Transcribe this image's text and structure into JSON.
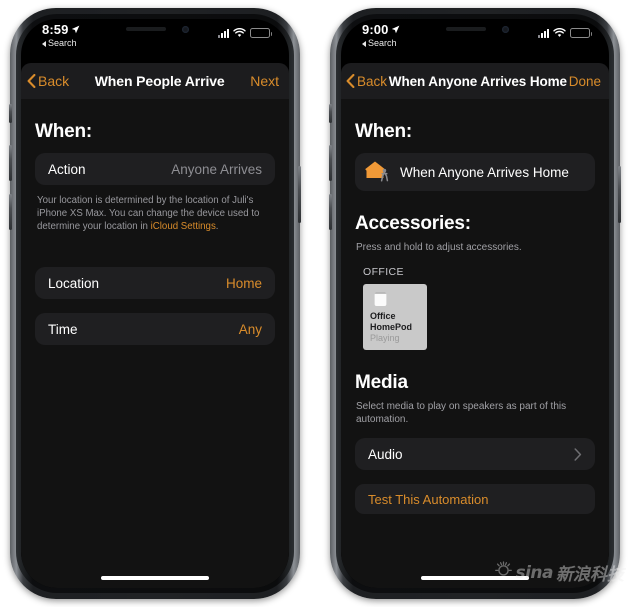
{
  "colors": {
    "accent_orange": "#d98c2b",
    "screen_bg": "#121212",
    "card_bg": "#1f1f21",
    "navbar_bg": "#1c1c1e",
    "secondary_text": "#8e8e93",
    "home_icon_orange": "#f09937"
  },
  "phones": [
    {
      "id": "left",
      "status_bar": {
        "time": "8:59",
        "location_icon": "location-arrow-icon",
        "back_app_label": "Search",
        "cellular_icon": "signal-bars-icon",
        "wifi_icon": "wifi-icon",
        "battery_icon": "battery-icon"
      },
      "nav": {
        "back_label": "Back",
        "back_icon": "chevron-left-icon",
        "title": "When People Arrive",
        "action_label": "Next"
      },
      "section_title": "When:",
      "action_row": {
        "label": "Action",
        "value": "Anyone Arrives"
      },
      "footnote": {
        "text_before": "Your location is determined by the location of Juli's iPhone XS Max. You can change the device used to determine your location in ",
        "link": "iCloud Settings",
        "text_after": "."
      },
      "location_row": {
        "label": "Location",
        "value": "Home"
      },
      "time_row": {
        "label": "Time",
        "value": "Any"
      }
    },
    {
      "id": "right",
      "status_bar": {
        "time": "9:00",
        "location_icon": "location-arrow-icon",
        "back_app_label": "Search",
        "cellular_icon": "signal-bars-icon",
        "wifi_icon": "wifi-icon",
        "battery_icon": "battery-icon"
      },
      "nav": {
        "back_label": "Back",
        "back_icon": "chevron-left-icon",
        "title": "When Anyone Arrives Home",
        "action_label": "Done"
      },
      "when": {
        "section_title": "When:",
        "trigger_icon": "home-arrival-icon",
        "trigger_label": "When Anyone Arrives Home"
      },
      "accessories": {
        "section_title": "Accessories:",
        "hint": "Press and hold to adjust accessories.",
        "group_label": "OFFICE",
        "items": [
          {
            "icon": "homepod-icon",
            "name_line1": "Office",
            "name_line2": "HomePod",
            "state": "Playing"
          }
        ]
      },
      "media": {
        "section_title": "Media",
        "description": "Select media to play on speakers as part of this automation.",
        "row_label": "Audio",
        "row_icon": "chevron-right-icon"
      },
      "test_button": {
        "label": "Test This Automation"
      }
    }
  ],
  "watermark": {
    "logo_icon": "sina-sun-icon",
    "latin": "sina",
    "chinese": "新浪科技"
  }
}
